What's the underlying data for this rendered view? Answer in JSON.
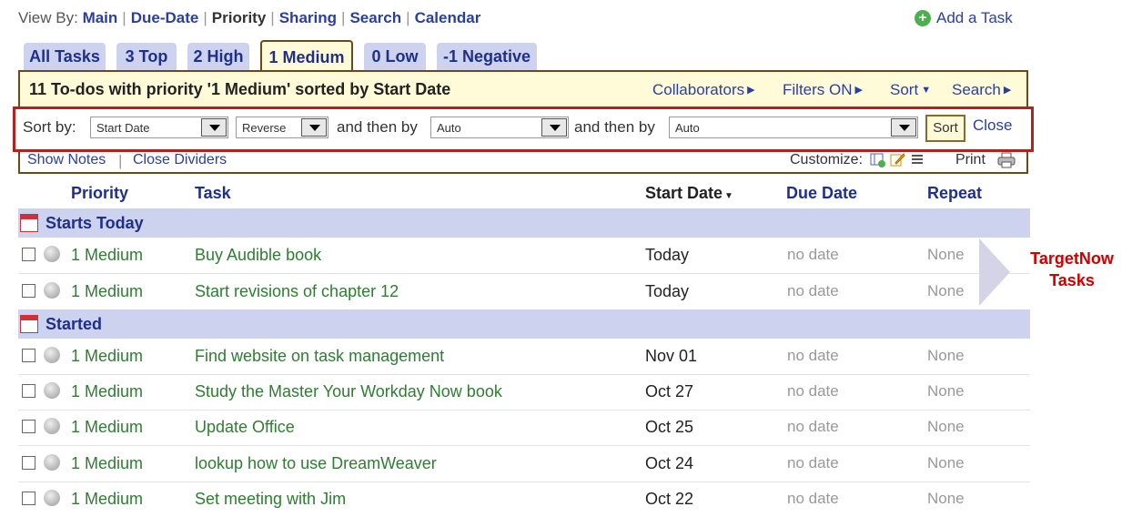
{
  "viewby": {
    "label": "View By:",
    "items": [
      {
        "label": "Main",
        "current": false
      },
      {
        "label": "Due-Date",
        "current": false
      },
      {
        "label": "Priority",
        "current": true
      },
      {
        "label": "Sharing",
        "current": false
      },
      {
        "label": "Search",
        "current": false
      },
      {
        "label": "Calendar",
        "current": false
      }
    ]
  },
  "add_task": "Add a Task",
  "tabs": [
    {
      "label": "All Tasks"
    },
    {
      "label": "3 Top"
    },
    {
      "label": "2 High"
    },
    {
      "label": "1 Medium",
      "active": true
    },
    {
      "label": "0 Low"
    },
    {
      "label": "-1 Negative"
    }
  ],
  "summary": {
    "text": "11 To-dos with priority '1 Medium' sorted by Start Date",
    "menus": [
      "Collaborators",
      "Filters ON",
      "Sort",
      "Search"
    ]
  },
  "sortbar": {
    "sort_by_label": "Sort by:",
    "field1": "Start Date",
    "order": "Reverse",
    "then_by_label": "and then by",
    "field2": "Auto",
    "field3": "Auto",
    "sort_button": "Sort",
    "close": "Close"
  },
  "notesbar": {
    "show_notes": "Show Notes",
    "close_dividers": "Close Dividers",
    "customize": "Customize:",
    "print": "Print"
  },
  "columns": {
    "priority": "Priority",
    "task": "Task",
    "start_date": "Start Date",
    "due_date": "Due Date",
    "repeat": "Repeat"
  },
  "groups": [
    {
      "label": "Starts Today",
      "rows": [
        {
          "priority": "1 Medium",
          "task": "Buy Audible book",
          "start": "Today",
          "due": "no date",
          "repeat": "None"
        },
        {
          "priority": "1 Medium",
          "task": "Start revisions of chapter 12",
          "start": "Today",
          "due": "no date",
          "repeat": "None"
        }
      ]
    },
    {
      "label": "Started",
      "rows": [
        {
          "priority": "1 Medium",
          "task": "Find website on task management",
          "start": "Nov 01",
          "due": "no date",
          "repeat": "None"
        },
        {
          "priority": "1 Medium",
          "task": "Study the Master Your Workday Now book",
          "start": "Oct 27",
          "due": "no date",
          "repeat": "None"
        },
        {
          "priority": "1 Medium",
          "task": "Update Office",
          "start": "Oct 25",
          "due": "no date",
          "repeat": "None"
        },
        {
          "priority": "1 Medium",
          "task": "lookup how to use DreamWeaver",
          "start": "Oct 24",
          "due": "no date",
          "repeat": "None"
        },
        {
          "priority": "1 Medium",
          "task": "Set meeting with Jim",
          "start": "Oct 22",
          "due": "no date",
          "repeat": "None"
        }
      ]
    }
  ],
  "annotation": {
    "line1": "TargetNow",
    "line2": "Tasks"
  },
  "colors": {
    "link": "#2a3fa0",
    "group_bg": "#cdd3ee",
    "summary_bg": "#fffbd9",
    "highlight_border": "#b22222",
    "annotation": "#cc0000",
    "task_text": "#2e7d32"
  }
}
